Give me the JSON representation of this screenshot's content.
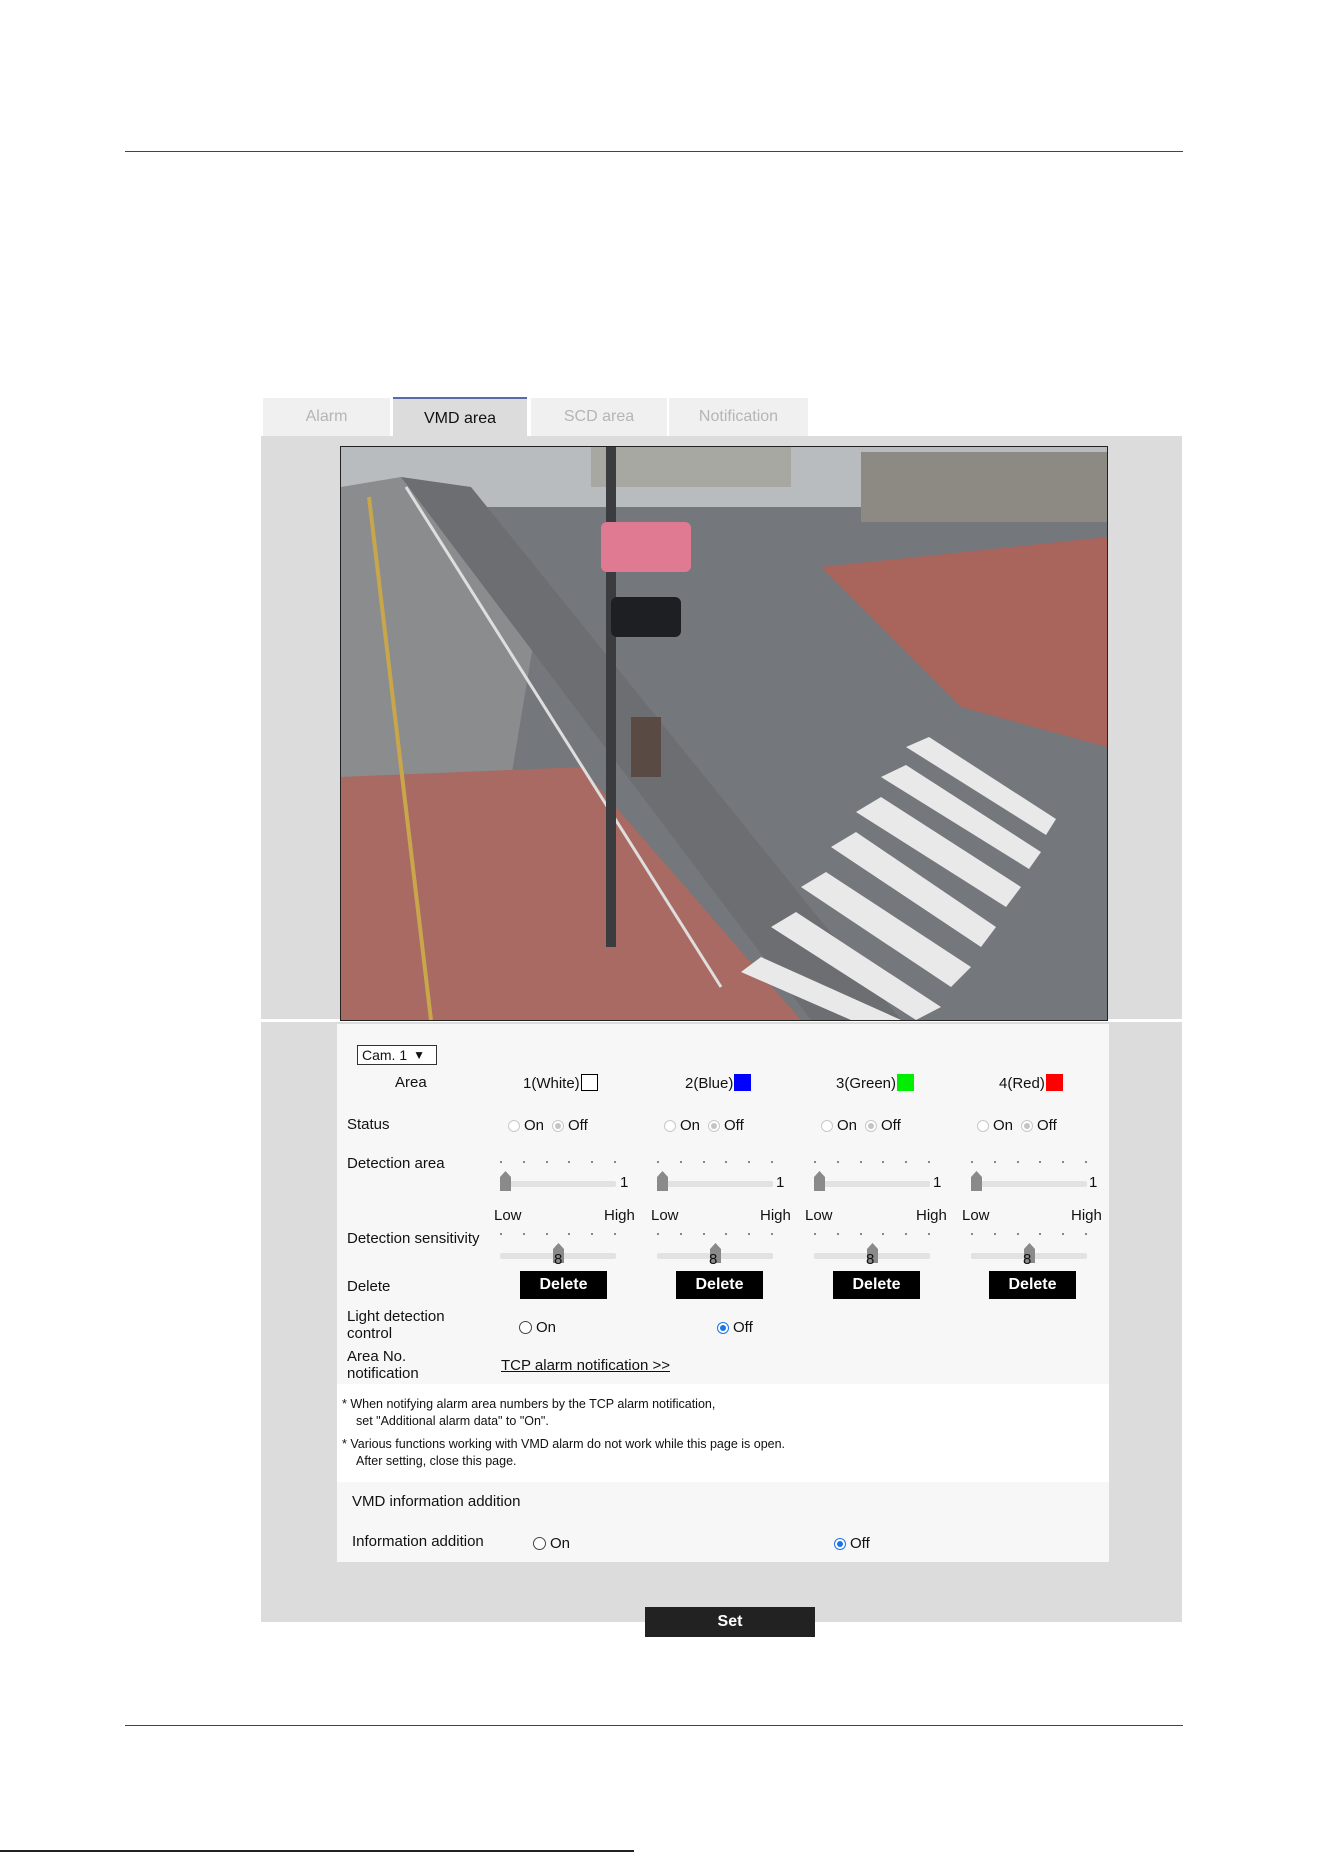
{
  "tabs": [
    {
      "label": "Alarm",
      "active": false
    },
    {
      "label": "VMD area",
      "active": true
    },
    {
      "label": "SCD area",
      "active": false
    },
    {
      "label": "Notification",
      "active": false
    }
  ],
  "camera_select": {
    "value": "Cam. 1"
  },
  "area_header": {
    "label": "Area",
    "areas": [
      {
        "label": "1(White)",
        "color": "#ffffff"
      },
      {
        "label": "2(Blue)",
        "color": "#0000ff"
      },
      {
        "label": "3(Green)",
        "color": "#00ee00"
      },
      {
        "label": "4(Red)",
        "color": "#ff0000"
      }
    ]
  },
  "status": {
    "label": "Status",
    "on_label": "On",
    "off_label": "Off",
    "values": [
      "Off",
      "Off",
      "Off",
      "Off"
    ]
  },
  "detection_area": {
    "label": "Detection area",
    "values": [
      1,
      1,
      1,
      1
    ],
    "max": 10
  },
  "detection_sensitivity": {
    "label": "Detection sensitivity",
    "low_label": "Low",
    "high_label": "High",
    "values": [
      8,
      8,
      8,
      8
    ],
    "max": 15
  },
  "delete_row": {
    "label": "Delete",
    "button_label": "Delete"
  },
  "light_detection": {
    "label_line1": "Light detection",
    "label_line2": "control",
    "on_label": "On",
    "off_label": "Off",
    "value": "Off"
  },
  "area_notification": {
    "label_line1": "Area No.",
    "label_line2": "notification",
    "link_label": "TCP alarm notification >>"
  },
  "notes": {
    "note1_line1": "* When notifying alarm area numbers by the TCP alarm notification,",
    "note1_line2": "set \"Additional alarm data\" to \"On\".",
    "note2_line1": "* Various functions working with VMD alarm do not work while this page is open.",
    "note2_line2": "After setting, close this page."
  },
  "vmd_info": {
    "title": "VMD information addition",
    "label": "Information addition",
    "on_label": "On",
    "off_label": "Off",
    "value": "Off"
  },
  "set_button": {
    "label": "Set"
  },
  "colors": {
    "active_tab_border": "#5a6aa8",
    "radio_selected": "#1a73e8",
    "panel_gray": "#dcdcdc"
  }
}
